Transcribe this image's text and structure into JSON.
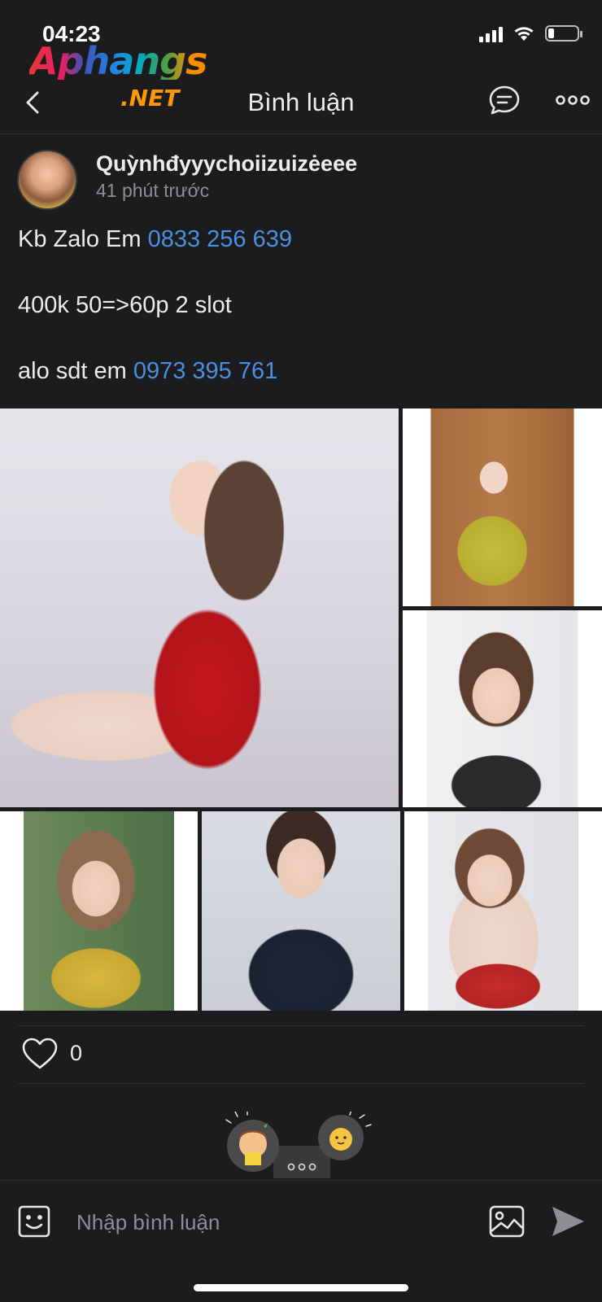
{
  "status_bar": {
    "time": "04:23",
    "battery_level": 0.2
  },
  "watermark": {
    "main": "Aphangs",
    "suffix": ".NET"
  },
  "nav": {
    "title": "Bình luận",
    "back_icon": "chevron-left-icon",
    "message_icon": "chat-bubble-icon",
    "more_icon": "more-horizontal-icon"
  },
  "post": {
    "author": "Quỳnhđyyychoiizuizėeee",
    "time_ago": "41 phút trước",
    "lines": [
      {
        "text": "Kb Zalo Em ",
        "phone": "0833 256 639"
      },
      {
        "text": "400k 50=>60p 2 slot",
        "phone": ""
      },
      {
        "text": "alo sdt em ",
        "phone": "0973 395 761"
      }
    ],
    "photo_count": 6
  },
  "reactions": {
    "like_count": "0",
    "like_icon": "heart-outline-icon"
  },
  "comment_box": {
    "placeholder": "Nhập bình luận",
    "emoji_icon": "sticker-icon",
    "image_icon": "image-icon",
    "send_icon": "send-icon"
  },
  "colors": {
    "background": "#1c1c1e",
    "link": "#4a90e2",
    "text": "#ececec",
    "muted": "#8e8e93"
  }
}
